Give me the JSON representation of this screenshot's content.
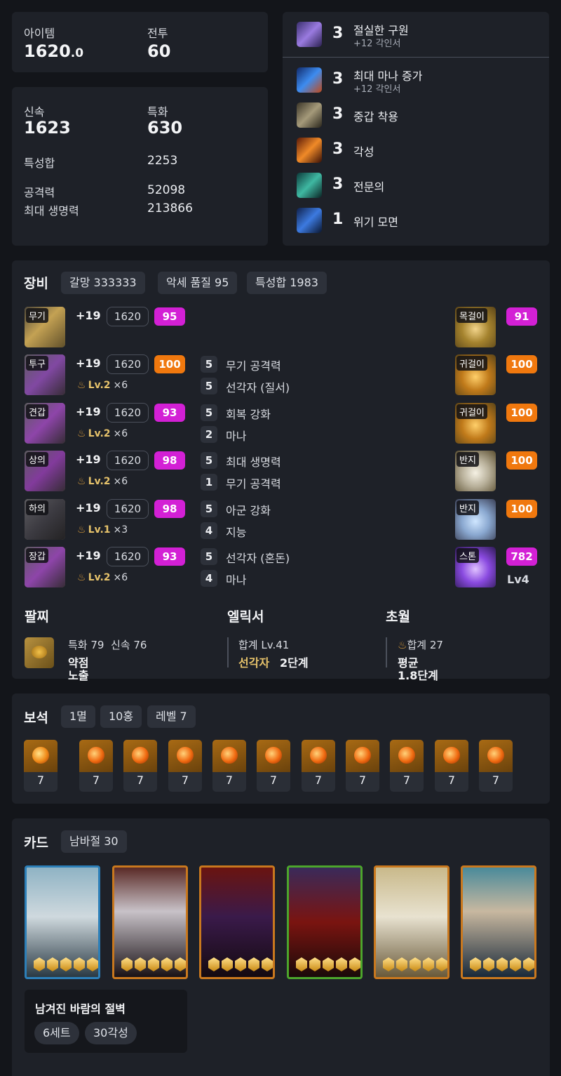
{
  "stats_top": {
    "item_label": "아이템",
    "item_value": "1620",
    "item_decimal": ".0",
    "combat_label": "전투",
    "combat_value": "60"
  },
  "stats_main": {
    "swift_label": "신속",
    "swift_value": "1623",
    "spec_label": "특화",
    "spec_value": "630",
    "total_label": "특성합",
    "total_value": "2253",
    "atk_label": "공격력",
    "atk_value": "52098",
    "hp_label": "최대 생명력",
    "hp_value": "213866"
  },
  "engravings": [
    {
      "level": "3",
      "name": "절실한 구원",
      "sub": "+12 각인서",
      "icon": "engraving-salvation-icon"
    },
    {
      "level": "3",
      "name": "최대 마나 증가",
      "sub": "+12 각인서",
      "icon": "engraving-mana-icon"
    },
    {
      "level": "3",
      "name": "중갑 착용",
      "sub": "",
      "icon": "engraving-armor-icon"
    },
    {
      "level": "3",
      "name": "각성",
      "sub": "",
      "icon": "engraving-awakening-icon"
    },
    {
      "level": "3",
      "name": "전문의",
      "sub": "",
      "icon": "engraving-expert-icon"
    },
    {
      "level": "1",
      "name": "위기 모면",
      "sub": "",
      "icon": "engraving-crisis-icon"
    }
  ],
  "equipment": {
    "title": "장비",
    "chips": [
      "갈망 333333",
      "악세 품질 95",
      "특성합 1983"
    ],
    "left": [
      {
        "slot": "무기",
        "enh": "+19",
        "ilvl": "1620",
        "quality": "95",
        "qcolor": "#d320d5",
        "lvl": "",
        "mult": "",
        "e1n": "",
        "e1": "",
        "e2n": "",
        "e2": ""
      },
      {
        "slot": "투구",
        "enh": "+19",
        "ilvl": "1620",
        "quality": "100",
        "qcolor": "#f0780e",
        "lvl": "Lv.2",
        "mult": "×6",
        "e1n": "5",
        "e1": "무기 공격력",
        "e2n": "5",
        "e2": "선각자 (질서)"
      },
      {
        "slot": "견갑",
        "enh": "+19",
        "ilvl": "1620",
        "quality": "93",
        "qcolor": "#d320d5",
        "lvl": "Lv.2",
        "mult": "×6",
        "e1n": "5",
        "e1": "회복 강화",
        "e2n": "2",
        "e2": "마나"
      },
      {
        "slot": "상의",
        "enh": "+19",
        "ilvl": "1620",
        "quality": "98",
        "qcolor": "#d320d5",
        "lvl": "Lv.2",
        "mult": "×6",
        "e1n": "5",
        "e1": "최대 생명력",
        "e2n": "1",
        "e2": "무기 공격력"
      },
      {
        "slot": "하의",
        "enh": "+19",
        "ilvl": "1620",
        "quality": "98",
        "qcolor": "#d320d5",
        "lvl": "Lv.1",
        "mult": "×3",
        "e1n": "5",
        "e1": "아군 강화",
        "e2n": "4",
        "e2": "지능"
      },
      {
        "slot": "장갑",
        "enh": "+19",
        "ilvl": "1620",
        "quality": "93",
        "qcolor": "#d320d5",
        "lvl": "Lv.2",
        "mult": "×6",
        "e1n": "5",
        "e1": "선각자 (혼돈)",
        "e2n": "4",
        "e2": "마나"
      }
    ],
    "right": [
      {
        "slot": "목걸이",
        "quality": "91",
        "qcolor": "#d320d5",
        "extra": ""
      },
      {
        "slot": "귀걸이",
        "quality": "100",
        "qcolor": "#f0780e",
        "extra": ""
      },
      {
        "slot": "귀걸이",
        "quality": "100",
        "qcolor": "#f0780e",
        "extra": ""
      },
      {
        "slot": "반지",
        "quality": "100",
        "qcolor": "#f0780e",
        "extra": ""
      },
      {
        "slot": "반지",
        "quality": "100",
        "qcolor": "#f0780e",
        "extra": ""
      },
      {
        "slot": "스톤",
        "quality": "782",
        "qcolor": "#d320d5",
        "extra": "Lv4"
      }
    ],
    "bracelet": {
      "title": "팔찌",
      "stats": "특화 79  신속 76",
      "effect_line1": "약점",
      "effect_line2": "노출"
    },
    "elixir": {
      "title": "엘릭서",
      "total": "합계 Lv.41",
      "name": "선각자",
      "stage": "2단계"
    },
    "transcend": {
      "title": "초월",
      "total": "합계 27",
      "avg_line1": "평균",
      "avg_line2": "1.8단계"
    }
  },
  "gems": {
    "title": "보석",
    "chips": [
      "1멸",
      "10홍",
      "레벨 7"
    ],
    "levels": [
      "7",
      "7",
      "7",
      "7",
      "7",
      "7",
      "7",
      "7",
      "7",
      "7",
      "7"
    ]
  },
  "cards": {
    "title": "카드",
    "chip": "남바절 30",
    "set_name": "남겨진 바람의 절벽",
    "set_chips": [
      "6세트",
      "30각성"
    ],
    "count": 6
  }
}
